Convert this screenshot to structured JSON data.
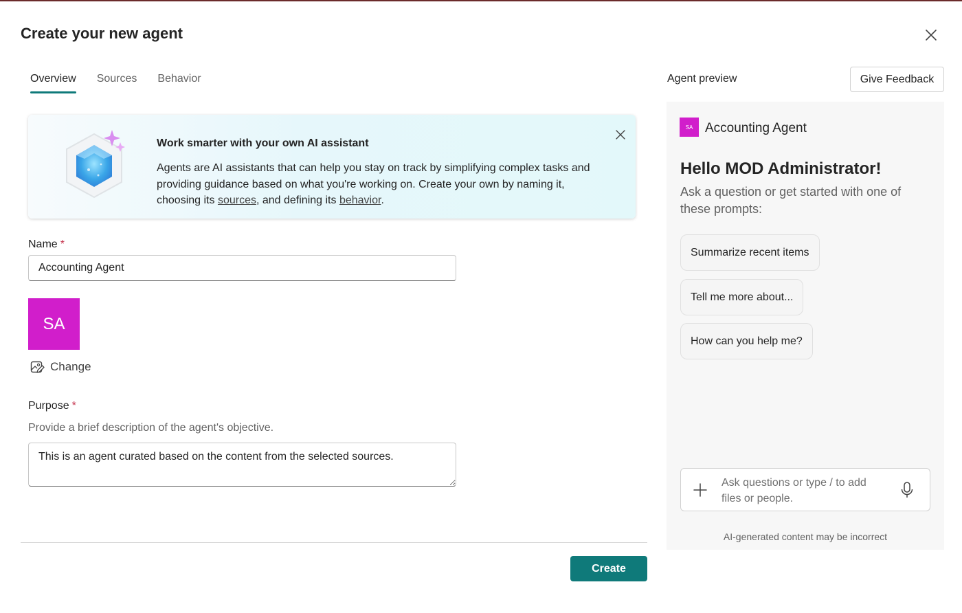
{
  "dialog": {
    "title": "Create your new agent"
  },
  "tabs": [
    {
      "label": "Overview",
      "active": true
    },
    {
      "label": "Sources",
      "active": false
    },
    {
      "label": "Behavior",
      "active": false
    }
  ],
  "banner": {
    "title": "Work smarter with your own AI assistant",
    "text_before": "Agents are AI assistants that can help you stay on track by simplifying complex tasks and providing guidance based on what you're working on. Create your own by naming it, choosing its ",
    "link_sources": "sources",
    "text_middle": ", and defining its ",
    "link_behavior": "behavior",
    "text_after": "."
  },
  "form": {
    "name_label": "Name",
    "required_mark": "*",
    "name_value": "Accounting Agent",
    "avatar_initials": "SA",
    "change_label": "Change",
    "purpose_label": "Purpose",
    "purpose_description": "Provide a brief description of the agent's objective.",
    "purpose_value": "This is an agent curated based on the content from the selected sources."
  },
  "footer": {
    "create_label": "Create"
  },
  "preview": {
    "title": "Agent preview",
    "feedback_label": "Give Feedback",
    "agent_initials": "SA",
    "agent_name": "Accounting Agent",
    "greeting": "Hello MOD Administrator!",
    "subtitle": "Ask a question or get started with one of these prompts:",
    "prompts": [
      "Summarize recent items",
      "Tell me more about...",
      "How can you help me?"
    ],
    "chat_placeholder": "Ask questions or type / to add files or people.",
    "disclaimer": "AI-generated content may be incorrect"
  },
  "colors": {
    "accent": "#0f7a7a",
    "avatar": "#d11ecb",
    "required": "#c4314b"
  },
  "icons": [
    "close-icon",
    "agent-hexagon-icon",
    "image-edit-icon",
    "plus-icon",
    "microphone-icon"
  ]
}
